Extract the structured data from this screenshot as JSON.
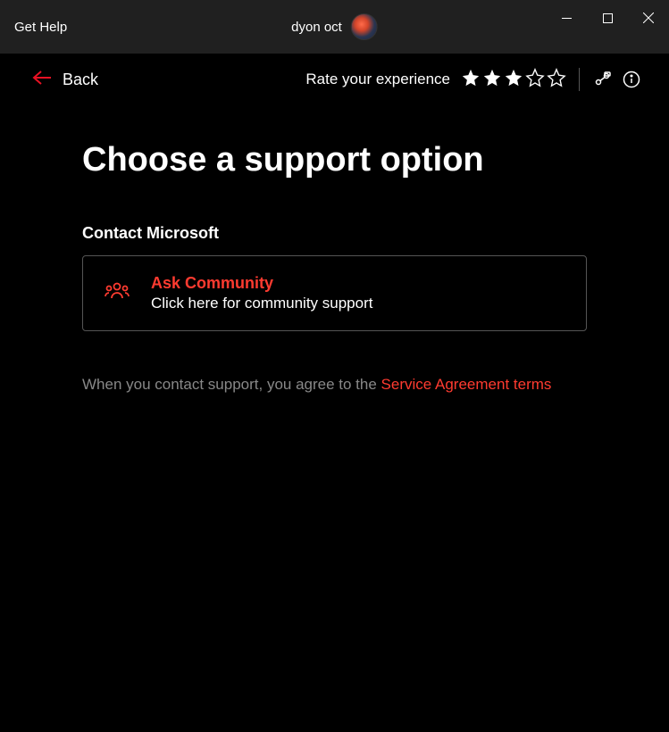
{
  "titlebar": {
    "app_title": "Get Help",
    "username": "dyon oct"
  },
  "toolbar": {
    "back_label": "Back",
    "rate_label": "Rate your experience",
    "rating_filled": 3,
    "rating_total": 5
  },
  "content": {
    "heading": "Choose a support option",
    "section_heading": "Contact Microsoft",
    "option": {
      "title": "Ask Community",
      "description": "Click here for community support"
    },
    "footer_prefix": "When you contact support, you agree to the ",
    "footer_link": "Service Agreement terms"
  },
  "colors": {
    "accent": "#ff3b30",
    "back_arrow": "#e81123"
  }
}
